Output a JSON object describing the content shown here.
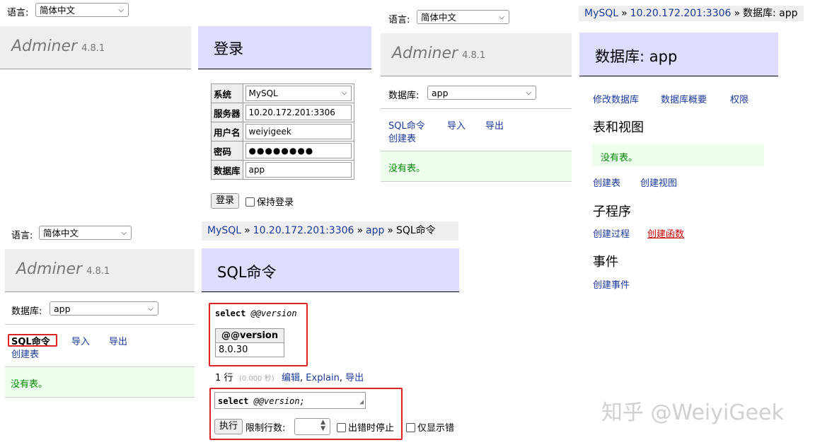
{
  "lang_label": "语言:",
  "lang_value": "简体中文",
  "chevron": "⌄",
  "adminer": {
    "name": "Adminer",
    "version": "4.8.1"
  },
  "login": {
    "title": "登录",
    "rows": [
      {
        "label": "系统",
        "value": "MySQL"
      },
      {
        "label": "服务器",
        "value": "10.20.172.201:3306"
      },
      {
        "label": "用户名",
        "value": "weiyigeek"
      },
      {
        "label": "密码",
        "value": "●●●●●●●●"
      },
      {
        "label": "数据库",
        "value": "app"
      }
    ],
    "submit": "登录",
    "remember": "保持登录"
  },
  "sidebar": {
    "db_label": "数据库:",
    "db_value": "app",
    "sql_cmd": "SQL命令",
    "import": "导入",
    "export": "导出",
    "create_table": "创建表",
    "no_tables": "没有表。"
  },
  "sql_page": {
    "breadcrumb": [
      "MySQL",
      "10.20.172.201:3306",
      "app",
      "SQL命令"
    ],
    "title": "SQL命令",
    "query_keyword": "select",
    "query_var": "@@version",
    "result_header": "@@version",
    "result_value": "8.0.30",
    "rows_count": "1 行",
    "time": "(0.000 秒)",
    "edit": "编辑",
    "explain": "Explain",
    "export": "导出",
    "editor_var": "@@version;",
    "execute": "执行",
    "limit_label": "限制行数:",
    "stop_on_error": "出错时停止",
    "errors_only": "仅显示错"
  },
  "db_page": {
    "breadcrumb": [
      "MySQL",
      "10.20.172.201:3306",
      "数据库: app"
    ],
    "title": "数据库: app",
    "links": [
      "修改数据库",
      "数据库概要",
      "权限"
    ],
    "tables_heading": "表和视图",
    "no_tables": "没有表。",
    "create_table": "创建表",
    "create_view": "创建视图",
    "routines_heading": "子程序",
    "create_procedure": "创建过程",
    "create_function": "创建函数",
    "events_heading": "事件",
    "create_event": "创建事件"
  },
  "watermark": "知乎 @WeiyiGeek"
}
